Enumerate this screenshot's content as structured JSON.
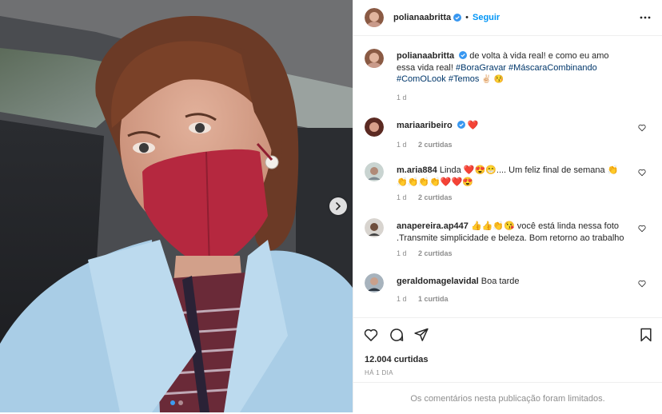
{
  "post": {
    "author": "polianaabritta",
    "follow_label": "Seguir",
    "separator": "•",
    "caption": {
      "text": "de volta à vida real! e como eu amo essa vida real!",
      "hashtags": [
        "#BoraGravar",
        "#MáscaraCombinando",
        "#ComOLook",
        "#Temos"
      ],
      "emoji": "✌🏻 😚",
      "time": "1 d"
    },
    "likes": "12.004 curtidas",
    "time_ago": "HÁ 1 DIA",
    "comments_limited": "Os comentários nesta publicação foram limitados."
  },
  "comments": [
    {
      "user": "mariaaribeiro",
      "verified": true,
      "text": "❤️",
      "time": "1 d",
      "likes": "2 curtidas"
    },
    {
      "user": "m.aria884",
      "verified": false,
      "text": "Linda ❤️😍😁.... Um feliz final de semana 👏👏👏👏👏❤️❤️😍",
      "time": "1 d",
      "likes": "2 curtidas"
    },
    {
      "user": "anapereira.ap447",
      "verified": false,
      "text": "👍👍👏😘 você está linda nessa foto .Transmite simplicidade e beleza. Bom retorno ao trabalho",
      "time": "1 d",
      "likes": "2 curtidas"
    },
    {
      "user": "geraldomagelavidal",
      "verified": false,
      "text": "Boa tarde",
      "time": "1 d",
      "likes": "1 curtida"
    }
  ],
  "colors": {
    "accent": "#0095f6",
    "hashtag": "#00376b",
    "muted": "#8e8e8e",
    "mask": "#b5283f",
    "jacket": "#a9cde6"
  },
  "icons": [
    "chevron-right-icon",
    "more-icon",
    "verified-icon",
    "heart-icon",
    "comment-icon",
    "share-icon",
    "bookmark-icon"
  ],
  "carousel": {
    "slides": 2,
    "current": 1
  }
}
